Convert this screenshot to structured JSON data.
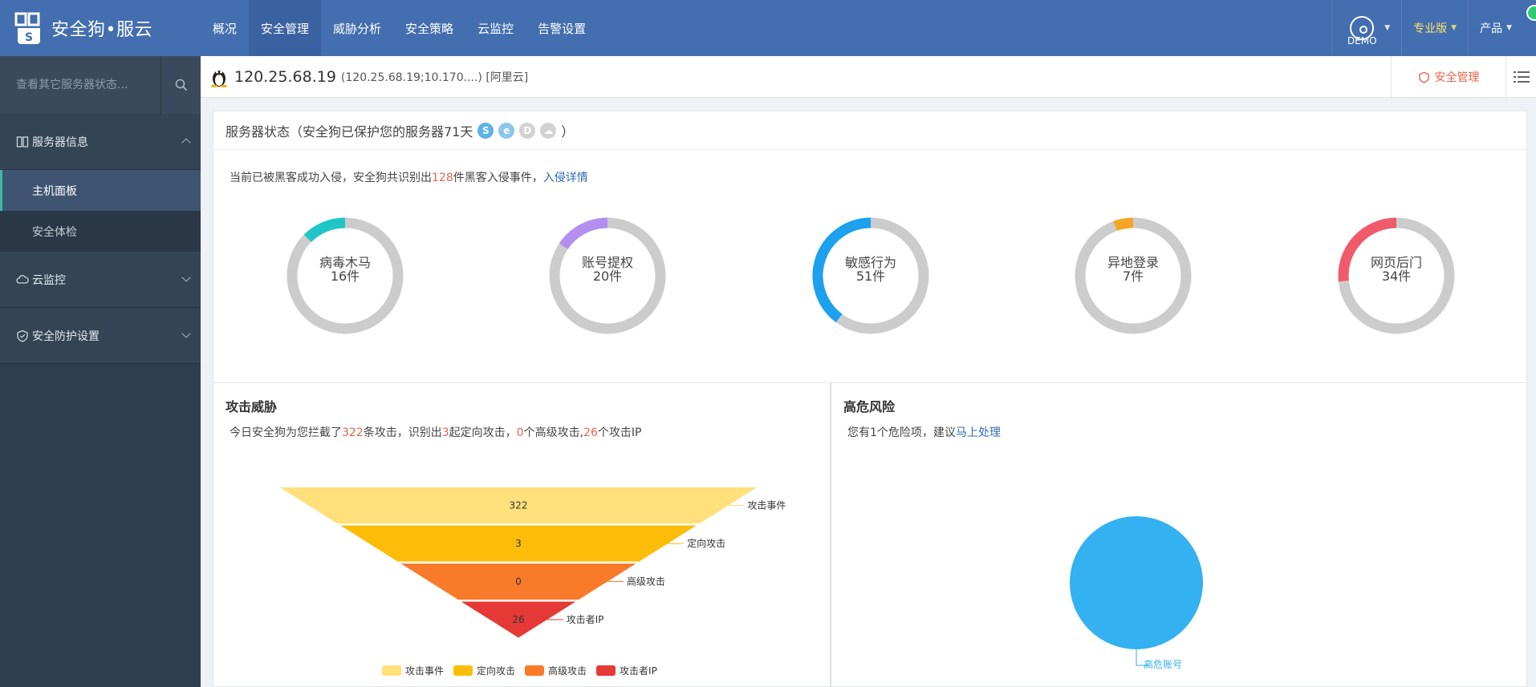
{
  "brand": {
    "name": "安全狗•服云"
  },
  "nav": {
    "items": [
      "概况",
      "安全管理",
      "威胁分析",
      "安全策略",
      "云监控",
      "告警设置"
    ],
    "active_index": 1
  },
  "top_right": {
    "demo": "DEMO",
    "edition": "专业版",
    "product": "产品"
  },
  "sidebar": {
    "search_placeholder": "查看其它服务器状态...",
    "group_server_info": "服务器信息",
    "sub_host_panel": "主机面板",
    "sub_security_check": "安全体检",
    "group_cloud_monitor": "云监控",
    "group_protection": "安全防护设置"
  },
  "server": {
    "ip": "120.25.68.19",
    "detail": "(120.25.68.19;10.170....) [阿里云]",
    "security_button": "安全管理"
  },
  "status": {
    "title": "服务器状态（安全狗已保护您的服务器71天",
    "title_close": "）",
    "badges": [
      "S",
      "e",
      "D"
    ],
    "intrusion_prefix": "当前已被黑客成功入侵，安全狗共识别出",
    "intrusion_count": "128",
    "intrusion_suffix": "件黑客入侵事件，",
    "intrusion_link": "入侵详情",
    "donuts": [
      {
        "name": "病毒木马",
        "count": "16件",
        "fraction": 0.125,
        "color": "#1ec6c8"
      },
      {
        "name": "账号提权",
        "count": "20件",
        "fraction": 0.156,
        "color": "#b38ff0"
      },
      {
        "name": "敏感行为",
        "count": "51件",
        "fraction": 0.398,
        "color": "#1ba1ee"
      },
      {
        "name": "异地登录",
        "count": "7件",
        "fraction": 0.055,
        "color": "#f5a623"
      },
      {
        "name": "网页后门",
        "count": "34件",
        "fraction": 0.266,
        "color": "#f05a6b"
      }
    ]
  },
  "attack": {
    "title": "攻击威胁",
    "line": {
      "p1": "今日安全狗为您拦截了",
      "v1": "322",
      "p2": "条攻击，识别出",
      "v2": "3",
      "p3": "起定向攻击，",
      "v3": "0",
      "p4": "个高级攻击,",
      "v4": "26",
      "p5": "个攻击IP"
    }
  },
  "chart_data": {
    "type": "funnel",
    "categories": [
      "攻击事件",
      "定向攻击",
      "高级攻击",
      "攻击者IP"
    ],
    "values": [
      322,
      3,
      0,
      26
    ],
    "colors": [
      "#ffe07a",
      "#fbbd08",
      "#f97b2a",
      "#e53935"
    ]
  },
  "risk": {
    "title": "高危风险",
    "line_prefix": "您有1个危险项，建议",
    "line_link": "马上处理",
    "pie": {
      "label": "高危账号",
      "value": 1,
      "color": "#33b1f0"
    }
  }
}
